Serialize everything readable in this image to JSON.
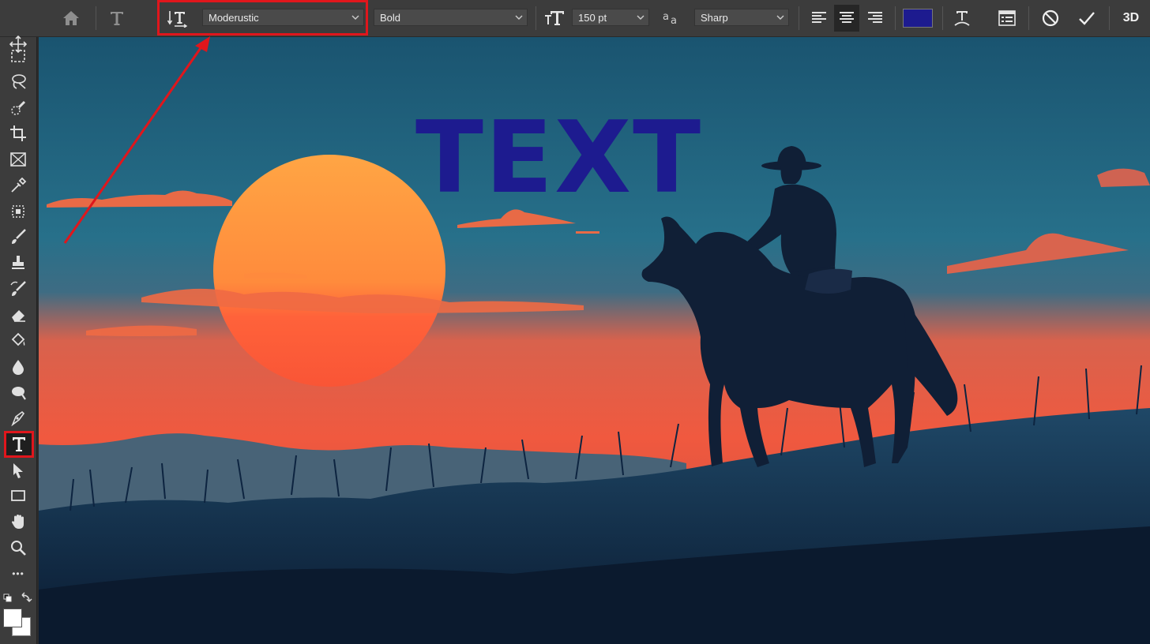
{
  "options_bar": {
    "home_icon": "home-icon",
    "tool_preset_icon": "type-tool-icon",
    "orientation_icon": "text-orientation-icon",
    "font_family": "Moderustic",
    "font_style": "Bold",
    "font_size_icon": "font-size-icon",
    "font_size": "150 pt",
    "antialias_icon": "antialias-icon",
    "antialias": "Sharp",
    "align_left_icon": "align-left-icon",
    "align_center_icon": "align-center-icon",
    "align_right_icon": "align-right-icon",
    "text_color": "#1d1b8f",
    "warp_icon": "warp-text-icon",
    "panels_icon": "character-panel-icon",
    "cancel_icon": "cancel-icon",
    "commit_icon": "commit-icon",
    "threed_label": "3D"
  },
  "toolbar": {
    "tools": [
      "move-icon",
      "marquee-icon",
      "lasso-icon",
      "quick-select-icon",
      "crop-icon",
      "frame-icon",
      "eyedropper-icon",
      "spot-heal-icon",
      "brush-icon",
      "stamp-icon",
      "history-brush-icon",
      "eraser-icon",
      "paint-bucket-icon",
      "blur-icon",
      "dodge-icon",
      "pen-icon",
      "type-icon",
      "path-select-icon",
      "rectangle-icon",
      "hand-icon",
      "zoom-icon",
      "more-tools-icon"
    ],
    "active_tool": "type-icon",
    "type_tool_glyph": "T",
    "more_glyph": "•••"
  },
  "canvas": {
    "headline": "TEXT"
  },
  "colors": {
    "highlight": "#e0161c",
    "sky_top": "#1d5a77",
    "sun": "#ff9a3c",
    "silhouette": "#0d1c33"
  }
}
